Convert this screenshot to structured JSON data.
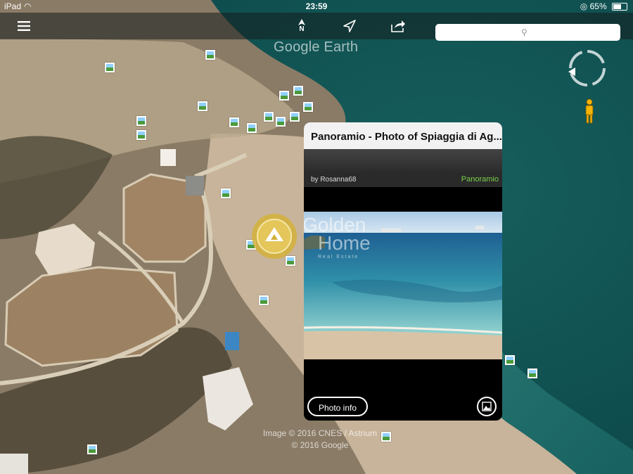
{
  "status_bar": {
    "device": "iPad",
    "time": "23:59",
    "battery": "65%",
    "battery_level": 0.65
  },
  "toolbar": {
    "menu_icon": "hamburger-icon",
    "north_label": "N",
    "north_icon": "north-arrow-icon",
    "location_icon": "location-arrow-icon",
    "share_icon": "share-icon",
    "search_placeholder": "",
    "search_icon": "search-icon"
  },
  "map": {
    "logo": "Google Earth",
    "attribution_line1": "Image © 2016 CNES / Astrium",
    "attribution_line2": "© 2016 Google",
    "colors": {
      "sea": "#0f5556",
      "sand": "#c8b49a",
      "land": "#8a7b66"
    }
  },
  "popup": {
    "title": "Panoramio - Photo of Spiaggia di Ag...",
    "author": "by Rosanna68",
    "brand": "Panoramio",
    "watermark_line1": "Golden",
    "watermark_line2": "Home",
    "watermark_sub": "Real Estate",
    "photo_info_label": "Photo info",
    "gallery_icon": "photo-gallery-icon"
  }
}
